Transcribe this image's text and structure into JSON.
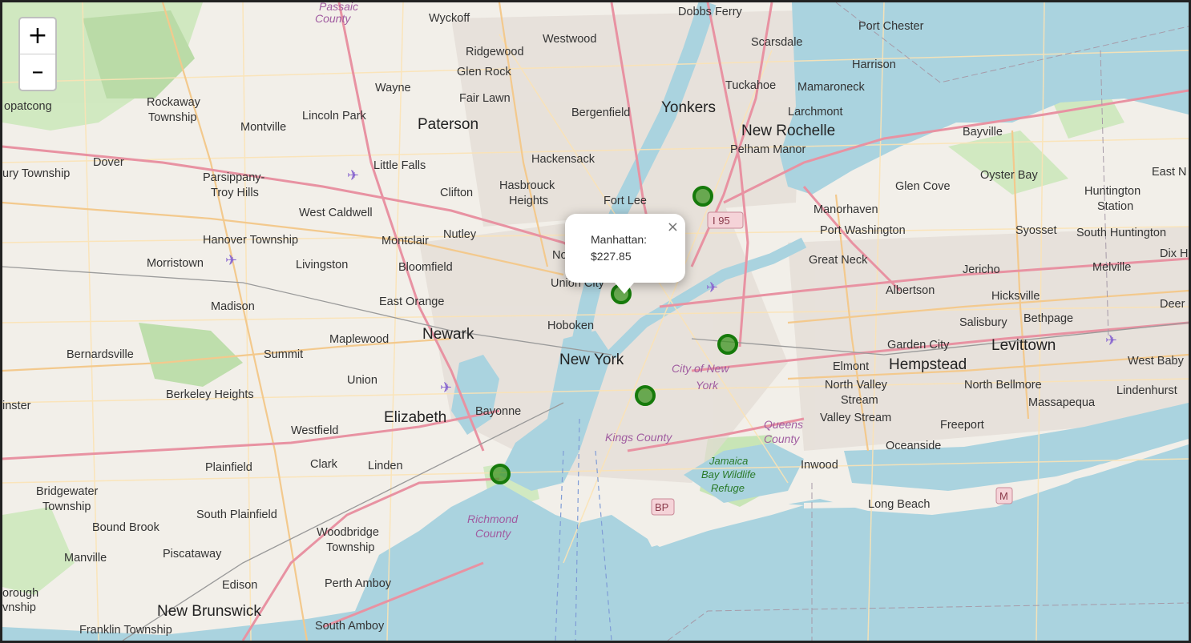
{
  "zoom": {
    "in_label": "+",
    "out_label": "–"
  },
  "popup": {
    "title": "Manhattan:",
    "price": "$227.85",
    "close_label": "×"
  },
  "markers": [
    {
      "id": "bronx",
      "color": "#167a0b"
    },
    {
      "id": "manhattan",
      "color": "#167a0b"
    },
    {
      "id": "queens",
      "color": "#167a0b"
    },
    {
      "id": "brooklyn",
      "color": "#167a0b"
    },
    {
      "id": "staten-island",
      "color": "#167a0b"
    }
  ],
  "labels": {
    "cities": [
      "Paterson",
      "Yonkers",
      "New Rochelle",
      "Newark",
      "New York",
      "Elizabeth",
      "Hempstead",
      "Levittown",
      "New Brunswick"
    ],
    "towns": [
      "Wyckoff",
      "Westwood",
      "Dobbs Ferry",
      "Port Chester",
      "Scarsdale",
      "Ridgewood",
      "Harrison",
      "Glen Rock",
      "Wayne",
      "Tuckahoe",
      "Mamaroneck",
      "Fair Lawn",
      "opatcong",
      "Rockaway",
      "Township",
      "Lincoln Park",
      "Bergenfield",
      "Larchmont",
      "Montville",
      "Pelham Manor",
      "Bayville",
      "Dover",
      "Hackensack",
      "ury Township",
      "Little Falls",
      "Oyster Bay",
      "East N",
      "Parsippany-",
      "Troy Hills",
      "Clifton",
      "Hasbrouck",
      "Heights",
      "Fort Lee",
      "Glen Cove",
      "Huntington",
      "Station",
      "West Caldwell",
      "Manorhaven",
      "Hanover Township",
      "Montclair",
      "Nutley",
      "Port Washington",
      "Syosset",
      "South Huntington",
      "Morristown",
      "Livingston",
      "Bloomfield",
      "Great Neck",
      "Melville",
      "Dix H",
      "Union City",
      "Jericho",
      "Madison",
      "East Orange",
      "Albertson",
      "Hicksville",
      "Deer",
      "Hoboken",
      "Bethpage",
      "Salisbury",
      "Maplewood",
      "Bernardsville",
      "Summit",
      "Garden City",
      "West Baby",
      "Elmont",
      "North Bellmore",
      "Union",
      "North Valley",
      "Stream",
      "Lindenhurst",
      "Berkeley Heights",
      "Massapequa",
      "inster",
      "Bayonne",
      "Valley Stream",
      "Westfield",
      "Freeport",
      "Oceanside",
      "Plainfield",
      "Clark",
      "Linden",
      "Inwood",
      "Bridgewater",
      "Township",
      "Long Beach",
      "South Plainfield",
      "Bound Brook",
      "Woodbridge",
      "Township",
      "Piscataway",
      "Manville",
      "Edison",
      "Perth Amboy",
      "orough",
      "vnship",
      "Franklin Township",
      "South Amboy",
      "No"
    ],
    "counties": [
      "Passaic",
      "County",
      "City of New",
      "York",
      "Kings County",
      "Queens",
      "County",
      "Richmond",
      "County"
    ],
    "parks": [
      "Jamaica",
      "Bay Wildlife",
      "Refuge"
    ],
    "shields": [
      "I 95",
      "BP",
      "M"
    ]
  },
  "colors": {
    "water": "#aad3df",
    "land": "#f2efe9",
    "motorway": "#e892a2",
    "primary": "#fcd6a4",
    "park": "#c8e6b4",
    "marker": "#167a0b"
  }
}
